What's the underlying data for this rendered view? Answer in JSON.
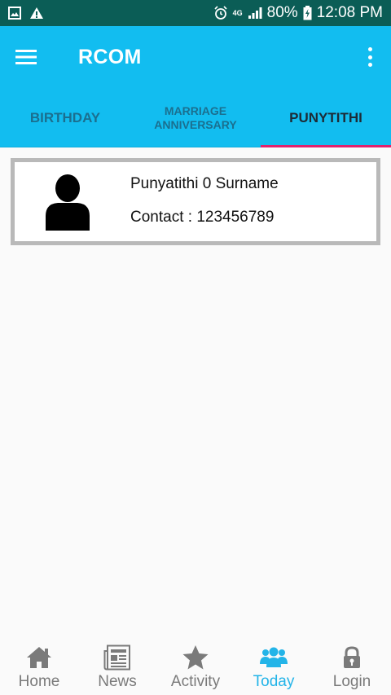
{
  "status_bar": {
    "battery": "80%",
    "time": "12:08 PM",
    "network": "4G"
  },
  "app_bar": {
    "title": "RCOM"
  },
  "tabs": [
    {
      "label": "BIRTHDAY",
      "active": false
    },
    {
      "label": "MARRIAGE ANNIVERSARY",
      "active": false
    },
    {
      "label": "PUNYTITHI",
      "active": true
    }
  ],
  "card": {
    "name": "Punyatithi 0 Surname",
    "contact": "Contact : 123456789"
  },
  "bottom_nav": [
    {
      "label": "Home",
      "icon": "home-icon",
      "active": false
    },
    {
      "label": "News",
      "icon": "newspaper-icon",
      "active": false
    },
    {
      "label": "Activity",
      "icon": "star-icon",
      "active": false
    },
    {
      "label": "Today",
      "icon": "people-icon",
      "active": true
    },
    {
      "label": "Login",
      "icon": "lock-icon",
      "active": false
    }
  ],
  "colors": {
    "status_bar": "#0b5d56",
    "primary": "#12bdf0",
    "tab_indicator": "#e0226e",
    "active_nav": "#23b4e8"
  }
}
